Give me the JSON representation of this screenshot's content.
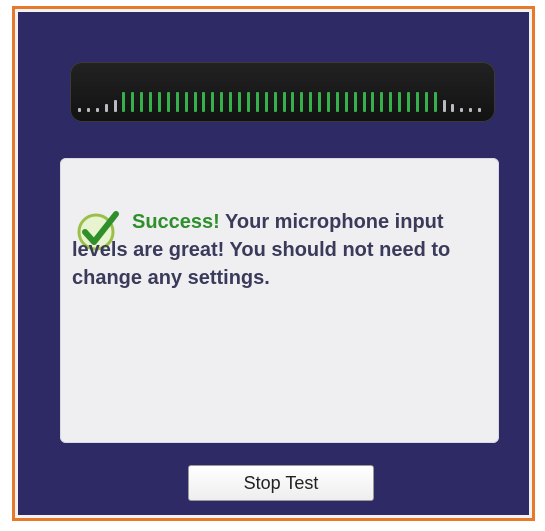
{
  "meter": {
    "bar_count": 46,
    "active_start": 5,
    "active_end": 40,
    "colors": {
      "active": "#35b04a",
      "inactive": "#b8bcc0"
    }
  },
  "message": {
    "success_label": "Success!",
    "body": "Your microphone input levels are great!  You should not need to change any settings.",
    "icon": "checkmark-icon"
  },
  "button": {
    "stop_label": "Stop Test"
  },
  "colors": {
    "frame_border": "#e8792a",
    "panel": "#2d2a66",
    "success_text": "#2f8f2a",
    "body_text": "#3a3a5a"
  }
}
